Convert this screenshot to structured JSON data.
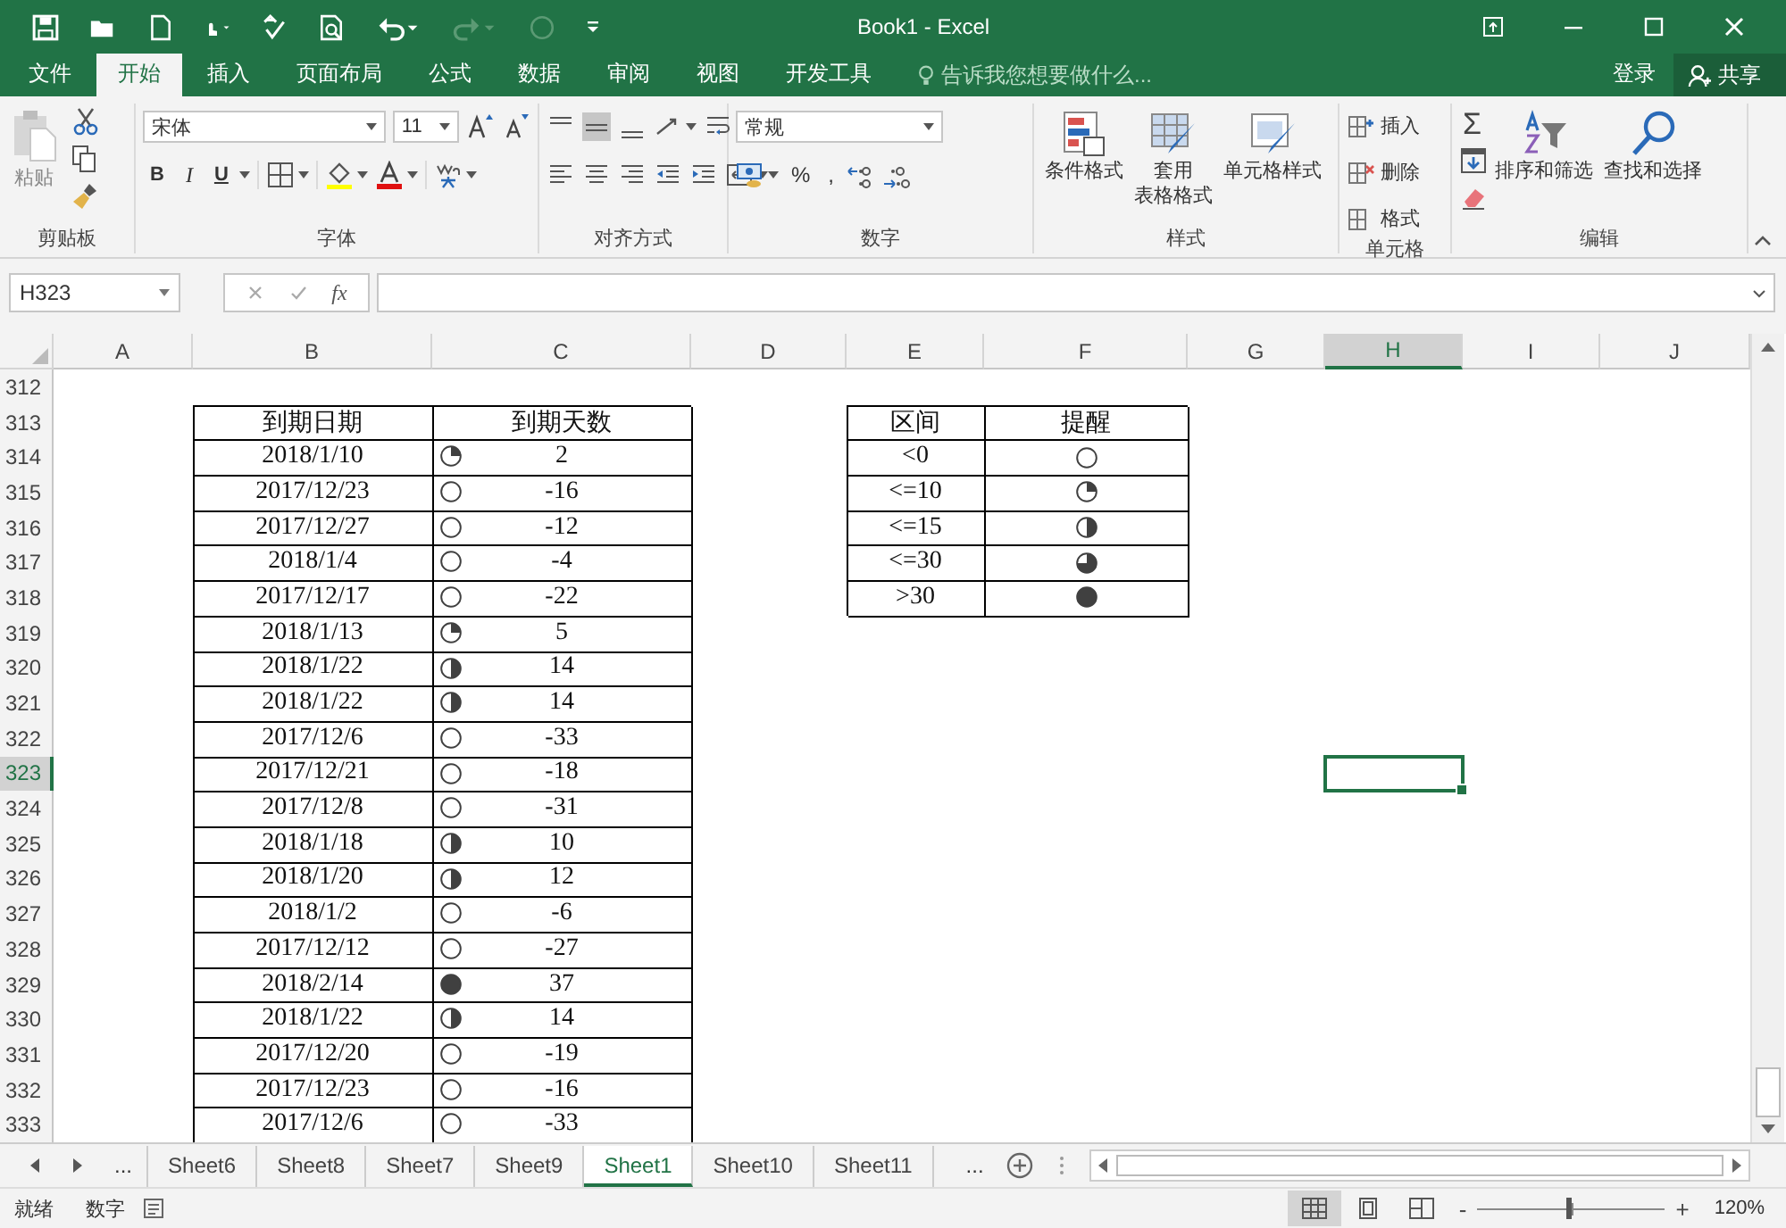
{
  "title_bar": {
    "title": "Book1 - Excel"
  },
  "ribbon_tabs": [
    {
      "label": "文件",
      "selected": false
    },
    {
      "label": "开始",
      "selected": true
    },
    {
      "label": "插入",
      "selected": false
    },
    {
      "label": "页面布局",
      "selected": false
    },
    {
      "label": "公式",
      "selected": false
    },
    {
      "label": "数据",
      "selected": false
    },
    {
      "label": "审阅",
      "selected": false
    },
    {
      "label": "视图",
      "selected": false
    },
    {
      "label": "开发工具",
      "selected": false
    }
  ],
  "tell_me": {
    "placeholder": "告诉我您想要做什么..."
  },
  "sign_in": "登录",
  "share": "共享",
  "ribbon": {
    "clipboard": {
      "label": "剪贴板",
      "paste": "粘贴"
    },
    "font": {
      "label": "字体",
      "font_name": "宋体",
      "font_size": "11",
      "style_buttons": [
        "B",
        "I",
        "U"
      ]
    },
    "alignment": {
      "label": "对齐方式"
    },
    "number": {
      "label": "数字",
      "format": "常规",
      "percent": "%",
      "comma": ","
    },
    "styles": {
      "label": "样式",
      "buttons": [
        {
          "kind": "conditional",
          "lines": [
            "条件格式"
          ]
        },
        {
          "kind": "table",
          "lines": [
            "套用",
            "表格格式"
          ]
        },
        {
          "kind": "cell-style",
          "lines": [
            "单元格样式"
          ]
        }
      ]
    },
    "cells": {
      "label": "单元格",
      "buttons": [
        {
          "kind": "insert",
          "label": "插入"
        },
        {
          "kind": "delete",
          "label": "删除"
        },
        {
          "kind": "format",
          "label": "格式"
        }
      ]
    },
    "editing": {
      "label": "编辑",
      "autosum": "Σ",
      "buttons": [
        {
          "kind": "sort",
          "label": "排序和筛选"
        },
        {
          "kind": "find",
          "label": "查找和选择"
        }
      ]
    }
  },
  "formula_bar": {
    "name_box": "H323",
    "function_label": "fx"
  },
  "sheet": {
    "columns": [
      {
        "label": "A",
        "selected": false
      },
      {
        "label": "B",
        "selected": false
      },
      {
        "label": "C",
        "selected": false
      },
      {
        "label": "D",
        "selected": false
      },
      {
        "label": "E",
        "selected": false
      },
      {
        "label": "F",
        "selected": false
      },
      {
        "label": "G",
        "selected": false
      },
      {
        "label": "H",
        "selected": true
      },
      {
        "label": "I",
        "selected": false
      },
      {
        "label": "J",
        "selected": false
      }
    ],
    "rows": [
      {
        "label": "312",
        "selected": false
      },
      {
        "label": "313",
        "selected": false
      },
      {
        "label": "314",
        "selected": false
      },
      {
        "label": "315",
        "selected": false
      },
      {
        "label": "316",
        "selected": false
      },
      {
        "label": "317",
        "selected": false
      },
      {
        "label": "318",
        "selected": false
      },
      {
        "label": "319",
        "selected": false
      },
      {
        "label": "320",
        "selected": false
      },
      {
        "label": "321",
        "selected": false
      },
      {
        "label": "322",
        "selected": false
      },
      {
        "label": "323",
        "selected": true
      },
      {
        "label": "324",
        "selected": false
      },
      {
        "label": "325",
        "selected": false
      },
      {
        "label": "326",
        "selected": false
      },
      {
        "label": "327",
        "selected": false
      },
      {
        "label": "328",
        "selected": false
      },
      {
        "label": "329",
        "selected": false
      },
      {
        "label": "330",
        "selected": false
      },
      {
        "label": "331",
        "selected": false
      },
      {
        "label": "332",
        "selected": false
      },
      {
        "label": "333",
        "selected": false
      }
    ],
    "tables": [
      {
        "header": [
          "到期日期",
          "到期天数"
        ],
        "rows": [
          [
            {
              "text": "2018/1/10"
            },
            {
              "kind": "quarter",
              "text": "2"
            }
          ],
          [
            {
              "text": "2017/12/23"
            },
            {
              "kind": "empty",
              "text": "-16"
            }
          ],
          [
            {
              "text": "2017/12/27"
            },
            {
              "kind": "empty",
              "text": "-12"
            }
          ],
          [
            {
              "text": "2018/1/4"
            },
            {
              "kind": "empty",
              "text": "-4"
            }
          ],
          [
            {
              "text": "2017/12/17"
            },
            {
              "kind": "empty",
              "text": "-22"
            }
          ],
          [
            {
              "text": "2018/1/13"
            },
            {
              "kind": "quarter",
              "text": "5"
            }
          ],
          [
            {
              "text": "2018/1/22"
            },
            {
              "kind": "half",
              "text": "14"
            }
          ],
          [
            {
              "text": "2018/1/22"
            },
            {
              "kind": "half",
              "text": "14"
            }
          ],
          [
            {
              "text": "2017/12/6"
            },
            {
              "kind": "empty",
              "text": "-33"
            }
          ],
          [
            {
              "text": "2017/12/21"
            },
            {
              "kind": "empty",
              "text": "-18"
            }
          ],
          [
            {
              "text": "2017/12/8"
            },
            {
              "kind": "empty",
              "text": "-31"
            }
          ],
          [
            {
              "text": "2018/1/18"
            },
            {
              "kind": "half",
              "text": "10"
            }
          ],
          [
            {
              "text": "2018/1/20"
            },
            {
              "kind": "half",
              "text": "12"
            }
          ],
          [
            {
              "text": "2018/1/2"
            },
            {
              "kind": "empty",
              "text": "-6"
            }
          ],
          [
            {
              "text": "2017/12/12"
            },
            {
              "kind": "empty",
              "text": "-27"
            }
          ],
          [
            {
              "text": "2018/2/14"
            },
            {
              "kind": "full",
              "text": "37"
            }
          ],
          [
            {
              "text": "2018/1/22"
            },
            {
              "kind": "half",
              "text": "14"
            }
          ],
          [
            {
              "text": "2017/12/20"
            },
            {
              "kind": "empty",
              "text": "-19"
            }
          ],
          [
            {
              "text": "2017/12/23"
            },
            {
              "kind": "empty",
              "text": "-16"
            }
          ],
          [
            {
              "text": "2017/12/6"
            },
            {
              "kind": "empty",
              "text": "-33"
            }
          ]
        ]
      },
      {
        "header": [
          "区间",
          "提醒"
        ],
        "rows": [
          [
            {
              "text": "<0"
            },
            {
              "kind": "empty"
            }
          ],
          [
            {
              "text": "<=10"
            },
            {
              "kind": "quarter"
            }
          ],
          [
            {
              "text": "<=15"
            },
            {
              "kind": "half"
            }
          ],
          [
            {
              "text": "<=30"
            },
            {
              "kind": "three-quarter"
            }
          ],
          [
            {
              "text": ">30"
            },
            {
              "kind": "full"
            }
          ]
        ]
      }
    ]
  },
  "sheet_tabs": {
    "more_left": "...",
    "tabs": [
      {
        "label": "Sheet6",
        "selected": false
      },
      {
        "label": "Sheet8",
        "selected": false
      },
      {
        "label": "Sheet7",
        "selected": false
      },
      {
        "label": "Sheet9",
        "selected": false
      },
      {
        "label": "Sheet1",
        "selected": true
      },
      {
        "label": "Sheet10",
        "selected": false
      },
      {
        "label": "Sheet11",
        "selected": false
      }
    ],
    "more_right": "..."
  },
  "status_bar": {
    "mode": "就绪",
    "num_lock": "数字",
    "views": [
      {
        "kind": "normal",
        "selected": true
      },
      {
        "kind": "page-layout",
        "selected": false
      },
      {
        "kind": "page-break",
        "selected": false
      }
    ],
    "zoom_out": "-",
    "zoom": {
      "level": 0.48
    },
    "zoom_in": "+",
    "zoom_label": "120%"
  }
}
